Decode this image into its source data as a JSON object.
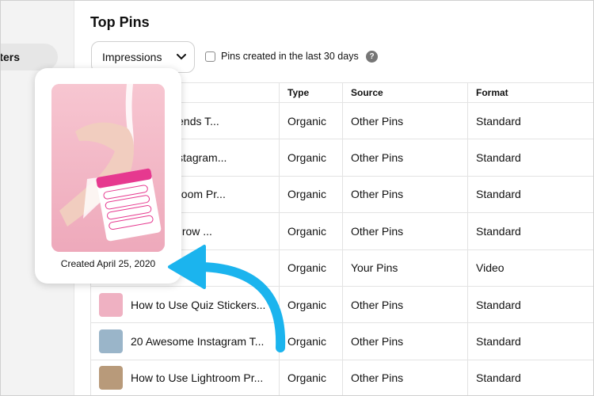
{
  "sidebar": {
    "active_item": "ters"
  },
  "header": {
    "title": "Top Pins"
  },
  "filters": {
    "metric_select": "Impressions",
    "checkbox_label": "Pins created in the last 30 days",
    "help_glyph": "?"
  },
  "table": {
    "columns": [
      "",
      "Type",
      "Source",
      "Format"
    ],
    "rows": [
      {
        "title": "Editing Trends T...",
        "type": "Organic",
        "source": "Other Pins",
        "format": "Standard",
        "thumb": "#e7a9b8"
      },
      {
        "title": "Design Instagram...",
        "type": "Organic",
        "source": "Other Pins",
        "format": "Standard",
        "thumb": "#c9a27e"
      },
      {
        "title": "Use Lightroom Pr...",
        "type": "Organic",
        "source": "Other Pins",
        "format": "Standard",
        "thumb": "#7e9bb0"
      },
      {
        "title": "Ways to Grow ...",
        "type": "Organic",
        "source": "Other Pins",
        "format": "Standard",
        "thumb": "#d6b38a"
      },
      {
        "title": "...",
        "type": "Organic",
        "source": "Your Pins",
        "format": "Video",
        "thumb": "#f2bfcc"
      },
      {
        "title": "How to Use Quiz Stickers...",
        "type": "Organic",
        "source": "Other Pins",
        "format": "Standard",
        "thumb": "#efb1c2"
      },
      {
        "title": "20 Awesome Instagram T...",
        "type": "Organic",
        "source": "Other Pins",
        "format": "Standard",
        "thumb": "#9ab5c9"
      },
      {
        "title": "How to Use Lightroom Pr...",
        "type": "Organic",
        "source": "Other Pins",
        "format": "Standard",
        "thumb": "#b89a7a"
      }
    ]
  },
  "popover": {
    "caption": "Created April 25, 2020"
  },
  "colors": {
    "arrow": "#1bb4ee",
    "accent_pink": "#e6398f",
    "sidebar_bg": "#f3f3f3"
  }
}
